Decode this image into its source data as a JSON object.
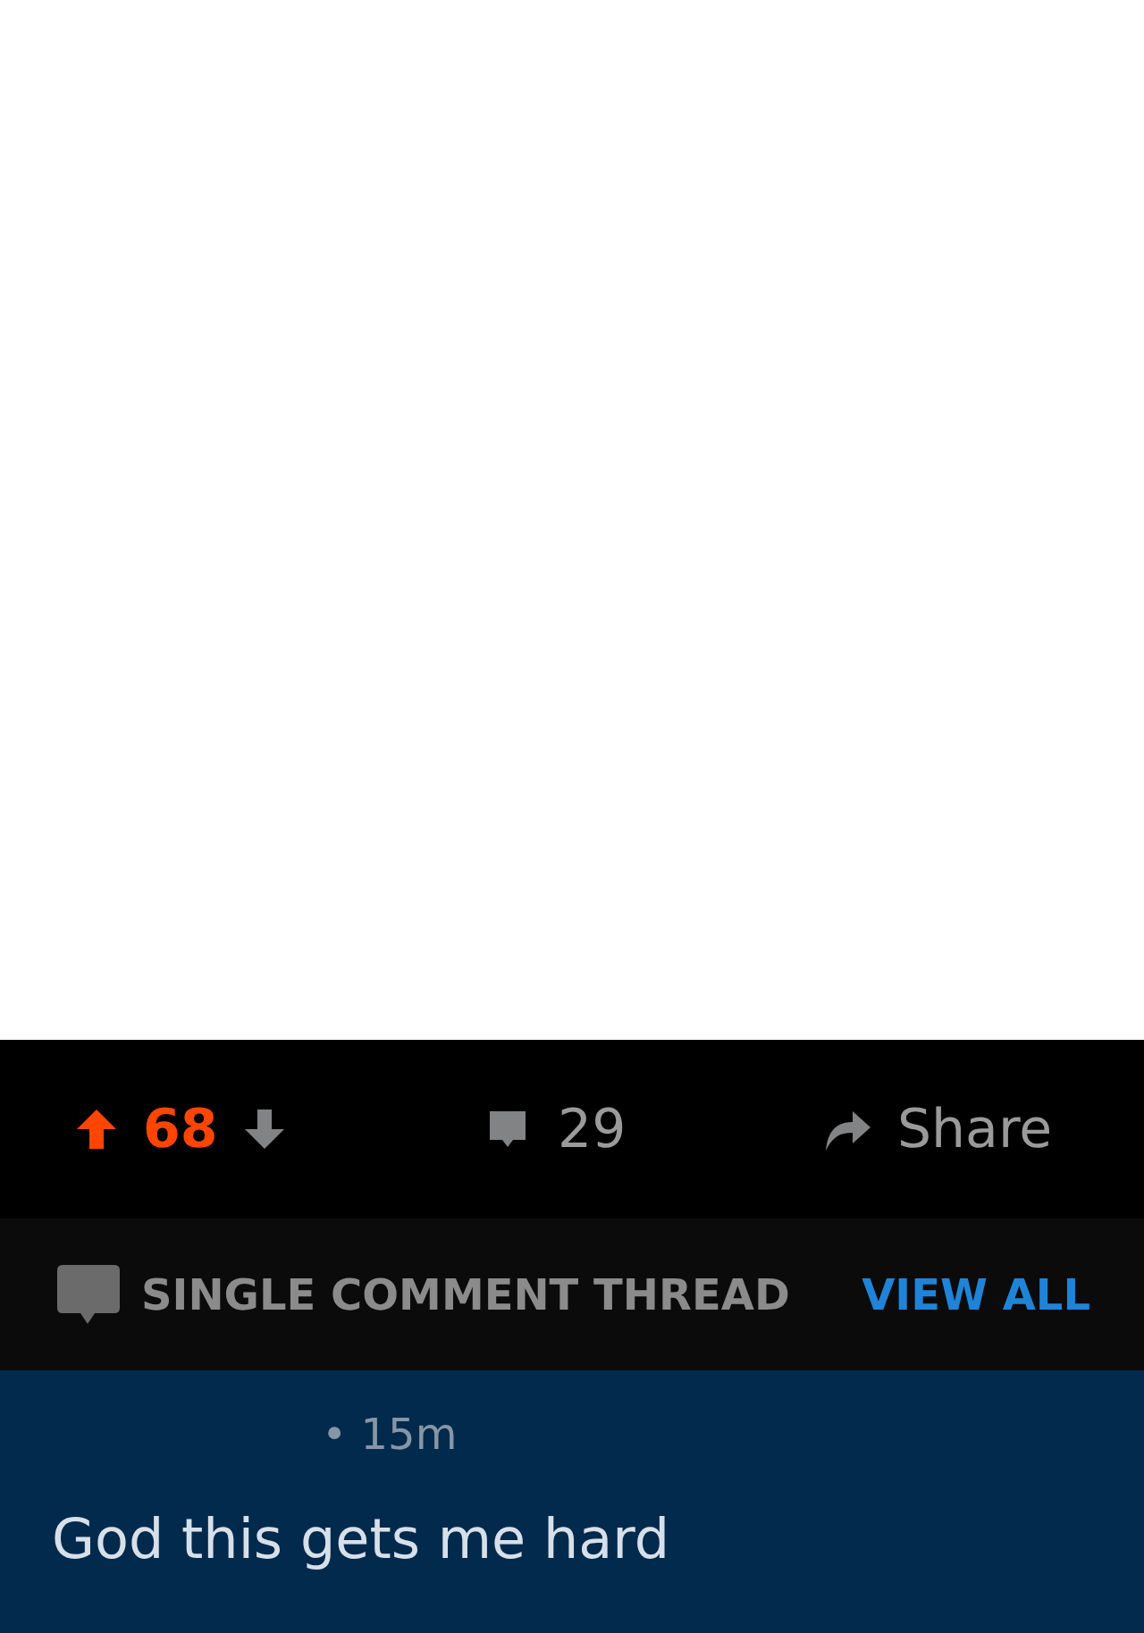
{
  "post_actions": {
    "upvoted": true,
    "score": "68",
    "comments": "29",
    "share": "Share"
  },
  "thread_bar": {
    "label": "SINGLE COMMENT THREAD",
    "link": "VIEW ALL"
  },
  "comment": {
    "time": "• 15m",
    "body": "God this gets me hard"
  }
}
